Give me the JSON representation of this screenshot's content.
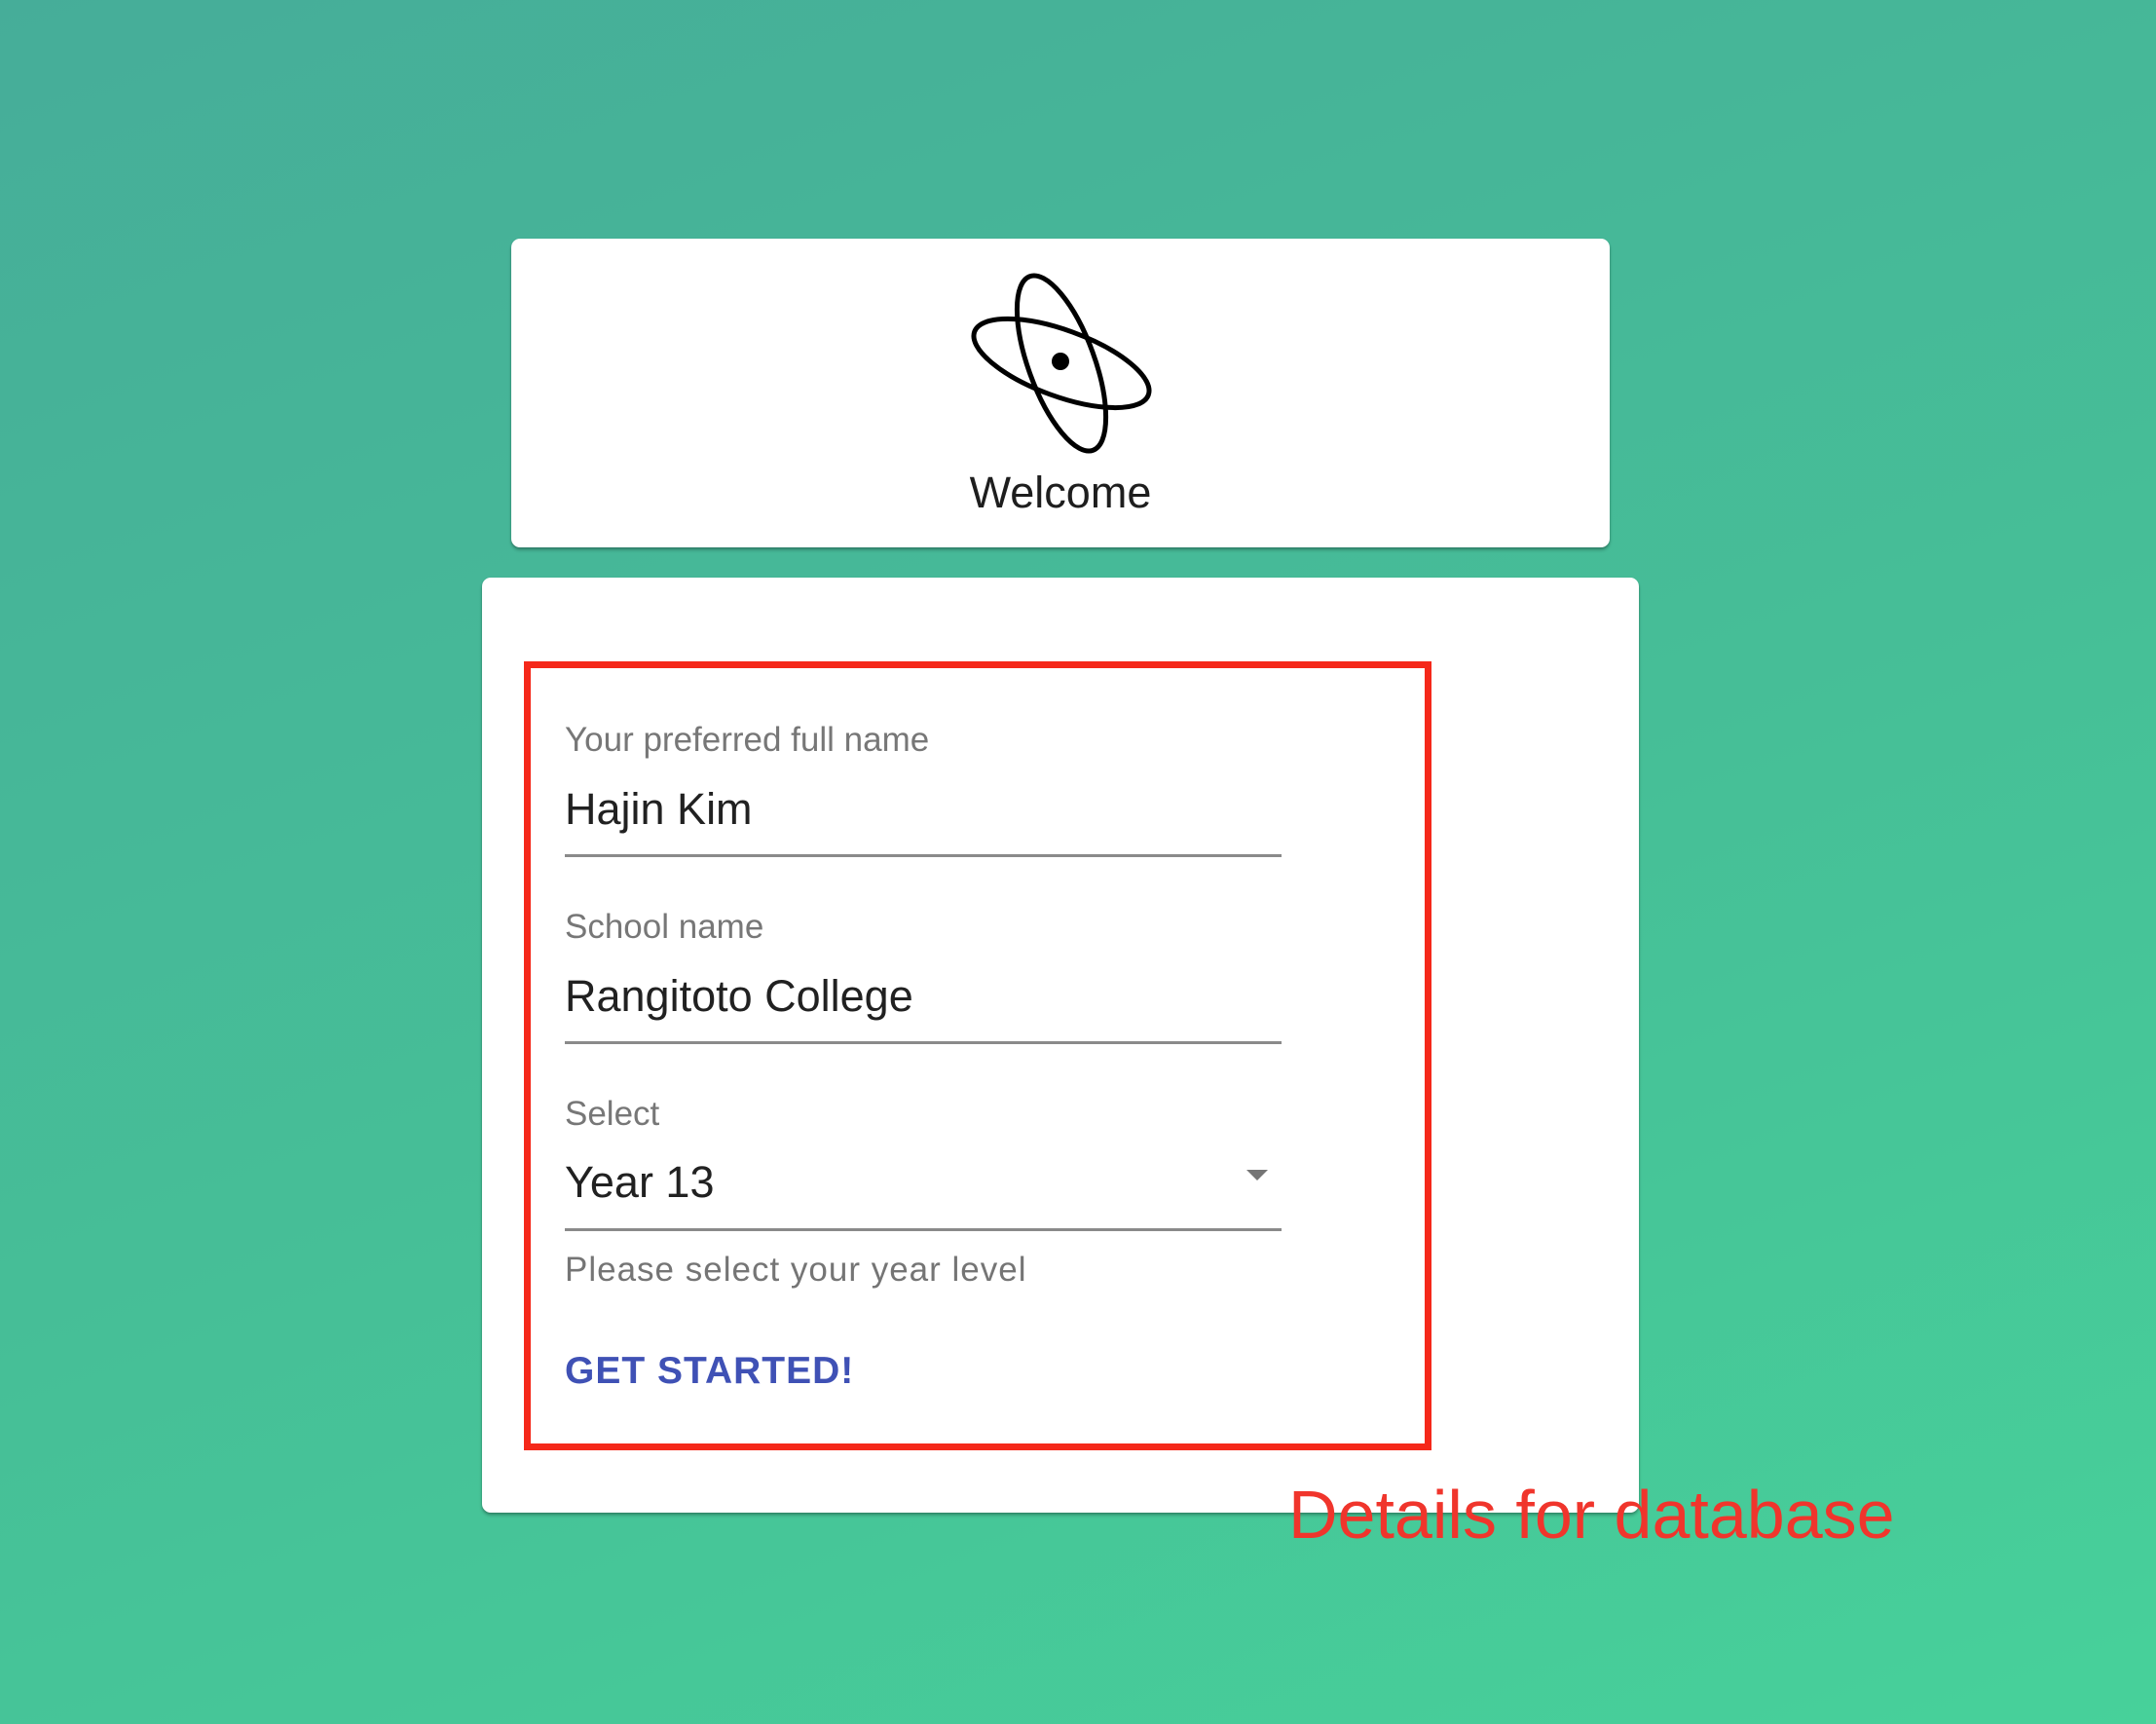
{
  "header": {
    "logo_icon": "atom-icon",
    "title": "Welcome"
  },
  "form": {
    "name_field": {
      "label": "Your preferred full name",
      "value": "Hajin Kim"
    },
    "school_field": {
      "label": "School name",
      "value": "Rangitoto College"
    },
    "year_select": {
      "label": "Select",
      "value": "Year 13",
      "helper_text": "Please select your year level",
      "icon": "dropdown-arrow-icon"
    },
    "submit_label": "GET STARTED!"
  },
  "annotation": {
    "text": "Details for database",
    "color": "#f5281a"
  },
  "colors": {
    "background_start": "#46ad99",
    "background_end": "#47d19a",
    "button_text": "#3f51b5"
  }
}
